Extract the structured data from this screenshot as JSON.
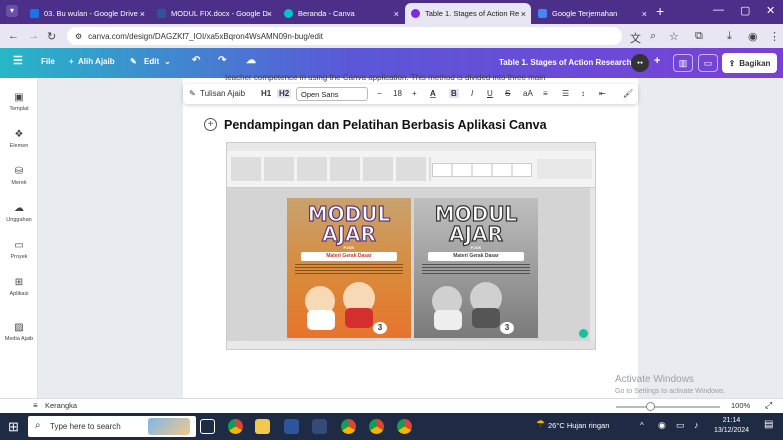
{
  "browser": {
    "tabs": [
      {
        "label": "03. Bu wulan - Google Drive",
        "color": "#1a73e8"
      },
      {
        "label": "MODUL FIX.docx - Google D",
        "color": "#2b579a"
      },
      {
        "label": "Beranda - Canva",
        "color": "#00c4cc"
      },
      {
        "label": "Table 1. Stages of Action Re",
        "color": "#7d2ae8"
      },
      {
        "label": "Google Terjemahan",
        "color": "#4285f4"
      }
    ],
    "url": "canva.com/design/DAGZKf7_IOI/xa5xBqron4WsAMN09n-bug/edit"
  },
  "canva": {
    "file_label": "File",
    "magic_label": "Alih Ajaib",
    "edit_label": "Edit",
    "doc_title": "Table 1. Stages of Action Research",
    "share_label": "Bagikan",
    "accent": "#7d2ae8"
  },
  "sidebar": {
    "items": [
      {
        "label": "Templat",
        "icon": "template-icon"
      },
      {
        "label": "Elemen",
        "icon": "elements-icon"
      },
      {
        "label": "Merek",
        "icon": "brand-icon"
      },
      {
        "label": "Unggahan",
        "icon": "upload-icon"
      },
      {
        "label": "Proyek",
        "icon": "folder-icon"
      },
      {
        "label": "Aplikasi",
        "icon": "apps-icon"
      },
      {
        "label": "Media Ajaib",
        "icon": "magic-media-icon"
      }
    ]
  },
  "editor": {
    "cut_text": "teacher competence in using the Canva application. This method is divided into three main",
    "text_toolbar": {
      "magic_write": "Tulisan Ajaib",
      "h1": "H1",
      "h2": "H2",
      "font": "Open Sans",
      "size": "18"
    },
    "heading": "Pendampingan dan Pelatihan Berbasis Aplikasi Canva"
  },
  "embedded": {
    "modul_title_1": "MODUL",
    "modul_title_2": "AJAR",
    "subject": "PJOK",
    "band": "Materi Gerak Dasar",
    "number": "3"
  },
  "bottom": {
    "notes_label": "Kerangka",
    "zoom": "100%",
    "activate_title": "Activate Windows",
    "activate_sub": "Go to Settings to activate Windows."
  },
  "taskbar": {
    "search_placeholder": "Type here to search",
    "weather": "26°C  Hujan ringan",
    "time": "21:14",
    "date": "13/12/2024"
  }
}
